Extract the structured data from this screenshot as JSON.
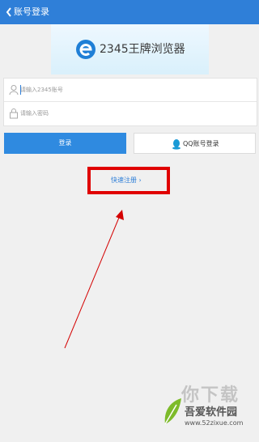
{
  "header": {
    "title": "账号登录"
  },
  "banner": {
    "text": "2345王牌浏览器"
  },
  "form": {
    "account_placeholder": "请输入2345账号",
    "password_placeholder": "请输入密码"
  },
  "buttons": {
    "login_label": "登录",
    "qq_login_label": "QQ账号登录"
  },
  "links": {
    "quick_register": "快速注册 ›"
  },
  "annotation": {
    "highlight_color": "#e00000"
  },
  "watermark": {
    "overlay_text": "你下载",
    "site_name": "吾爱软件园",
    "site_url": "www.52zixue.com"
  },
  "colors": {
    "primary": "#2f7fd8",
    "login_button": "#2f8ae0"
  }
}
